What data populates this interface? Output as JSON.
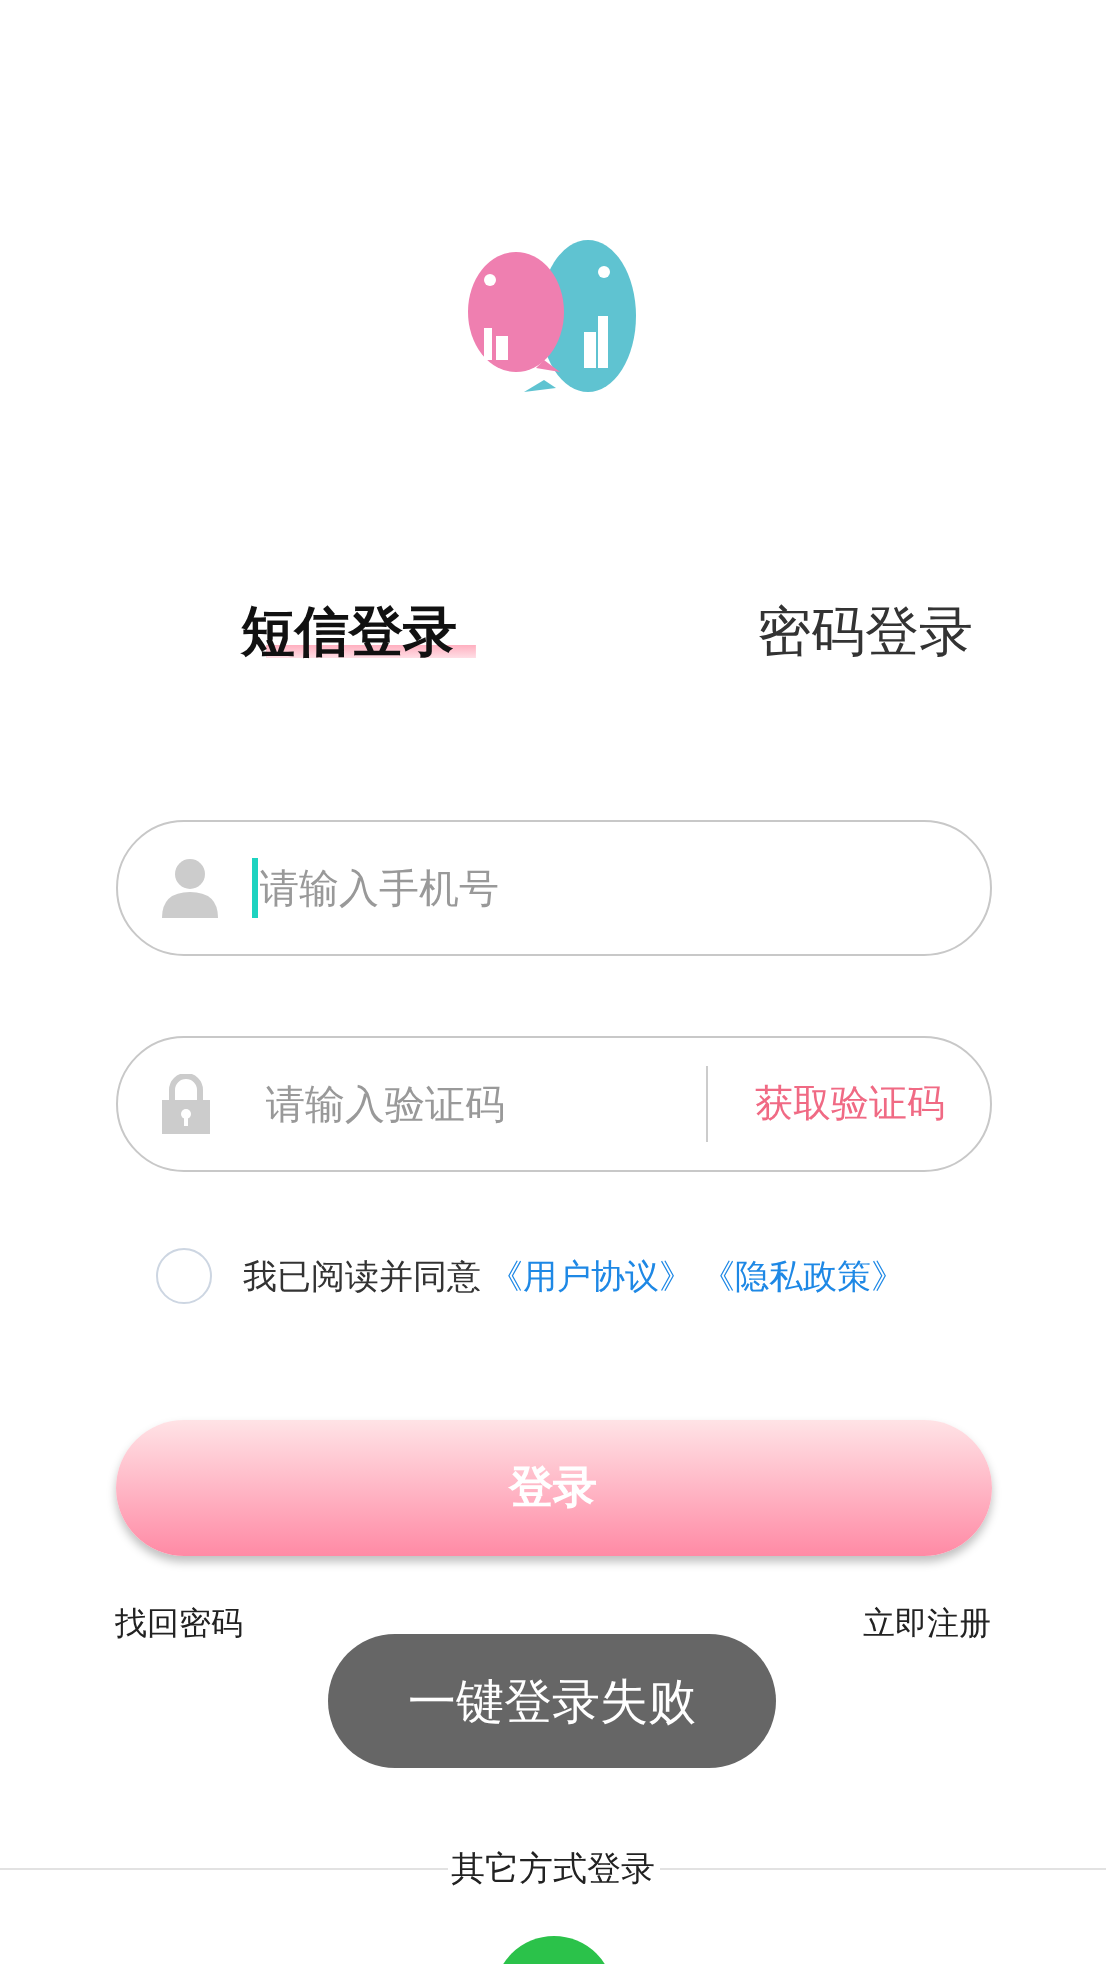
{
  "tabs": [
    {
      "label": "短信登录",
      "selected": true
    },
    {
      "label": "密码登录",
      "selected": false
    }
  ],
  "phone_field": {
    "placeholder": "请输入手机号",
    "focused": true
  },
  "code_field": {
    "placeholder": "请输入验证码",
    "action": "获取验证码"
  },
  "agreement": {
    "checked": false,
    "text": "我已阅读并同意",
    "links": [
      "《用户协议》",
      "《隐私政策》"
    ]
  },
  "login_button": "登录",
  "links": [
    "找回密码",
    "立即注册"
  ],
  "toast": "一键登录失败",
  "other_login": {
    "title": "其它方式登录"
  }
}
